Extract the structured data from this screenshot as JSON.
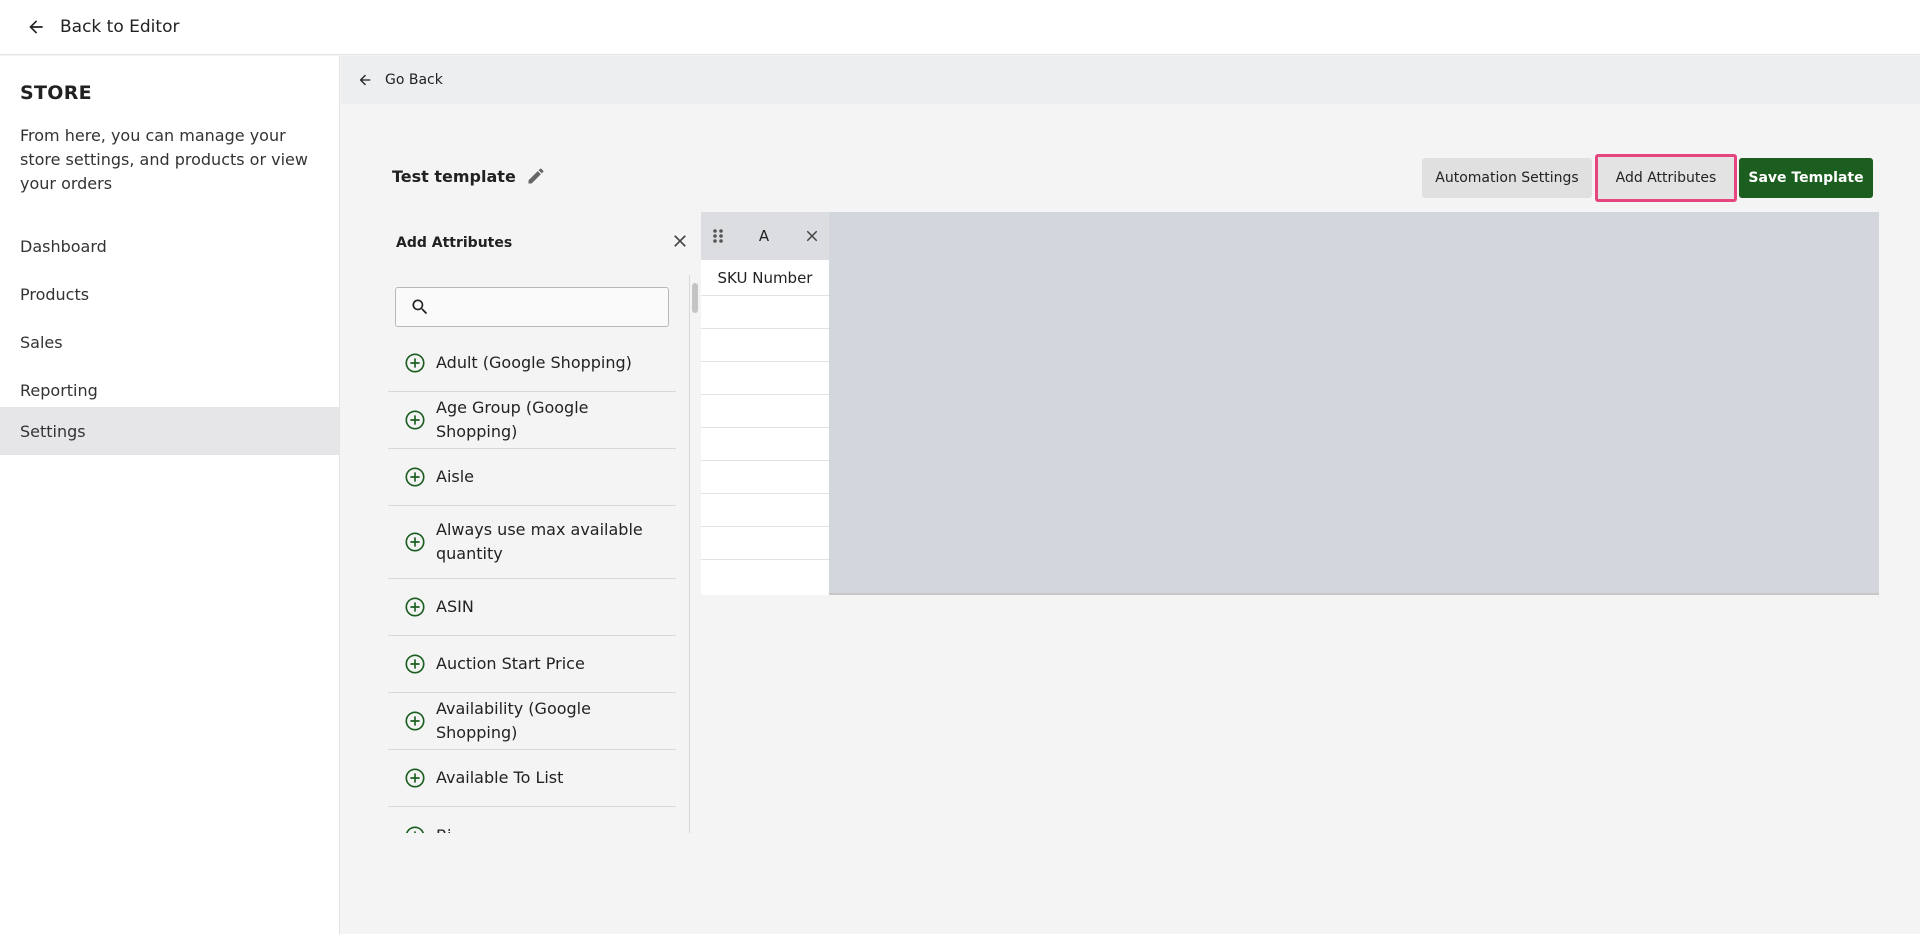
{
  "topbar": {
    "back_label": "Back to Editor"
  },
  "sidebar": {
    "title": "STORE",
    "description": "From here, you can manage your store settings, and products or view your orders",
    "items": [
      {
        "label": "Dashboard",
        "active": false
      },
      {
        "label": "Products",
        "active": false
      },
      {
        "label": "Sales",
        "active": false
      },
      {
        "label": "Reporting",
        "active": false
      },
      {
        "label": "Settings",
        "active": true
      }
    ]
  },
  "main": {
    "go_back_label": "Go Back",
    "template_name": "Test template",
    "buttons": {
      "automation": "Automation Settings",
      "add_attributes": "Add Attributes",
      "save_template": "Save Template"
    }
  },
  "attributes_panel": {
    "title": "Add Attributes",
    "search_value": "",
    "items": [
      "Adult (Google Shopping)",
      "Age Group (Google Shopping)",
      "Aisle",
      "Always use max available quantity",
      "ASIN",
      "Auction Start Price",
      "Availability (Google Shopping)",
      "Available To List",
      "Bi..."
    ]
  },
  "grid": {
    "column_letter": "A",
    "column_header": "SKU Number"
  },
  "colors": {
    "accent": "#1b5e20",
    "highlight": "#e6467f"
  }
}
